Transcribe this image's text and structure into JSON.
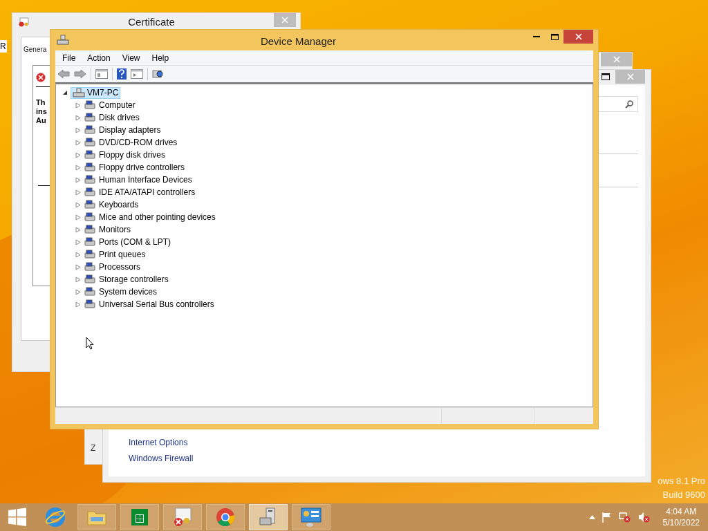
{
  "desktop": {
    "edge_text": "R",
    "watermark": [
      "ows 8.1 Pro",
      "Build 9600"
    ]
  },
  "certificate_window": {
    "title": "Certificate",
    "tab": "Genera",
    "lines": [
      "Th",
      "ins",
      "Au"
    ]
  },
  "back_window": {
    "text": "Z"
  },
  "control_panel_window": {
    "links": [
      "Internet Options",
      "Windows Firewall"
    ]
  },
  "device_manager": {
    "title": "Device Manager",
    "menu": [
      "File",
      "Action",
      "View",
      "Help"
    ],
    "tree": {
      "label": "VM7-PC",
      "selected": true,
      "expanded": true,
      "children": [
        {
          "label": "Computer",
          "expanded": false
        },
        {
          "label": "Disk drives",
          "expanded": false
        },
        {
          "label": "Display adapters",
          "expanded": false
        },
        {
          "label": "DVD/CD-ROM drives",
          "expanded": false
        },
        {
          "label": "Floppy disk drives",
          "expanded": false
        },
        {
          "label": "Floppy drive controllers",
          "expanded": false
        },
        {
          "label": "Human Interface Devices",
          "expanded": false
        },
        {
          "label": "IDE ATA/ATAPI controllers",
          "expanded": false
        },
        {
          "label": "Keyboards",
          "expanded": false
        },
        {
          "label": "Mice and other pointing devices",
          "expanded": false
        },
        {
          "label": "Monitors",
          "expanded": false
        },
        {
          "label": "Ports (COM & LPT)",
          "expanded": false
        },
        {
          "label": "Print queues",
          "expanded": false
        },
        {
          "label": "Processors",
          "expanded": false
        },
        {
          "label": "Storage controllers",
          "expanded": false
        },
        {
          "label": "System devices",
          "expanded": false
        },
        {
          "label": "Universal Serial Bus controllers",
          "expanded": false
        }
      ]
    }
  },
  "taskbar": {
    "apps": [
      {
        "kind": "folder",
        "selected": false
      },
      {
        "kind": "store",
        "selected": false
      },
      {
        "kind": "certificate",
        "selected": false
      },
      {
        "kind": "browser",
        "selected": false
      },
      {
        "kind": "computer",
        "selected": true
      },
      {
        "kind": "panel",
        "selected": false
      }
    ],
    "clock": {
      "time": "4:04 AM",
      "date": "5/10/2022"
    }
  }
}
